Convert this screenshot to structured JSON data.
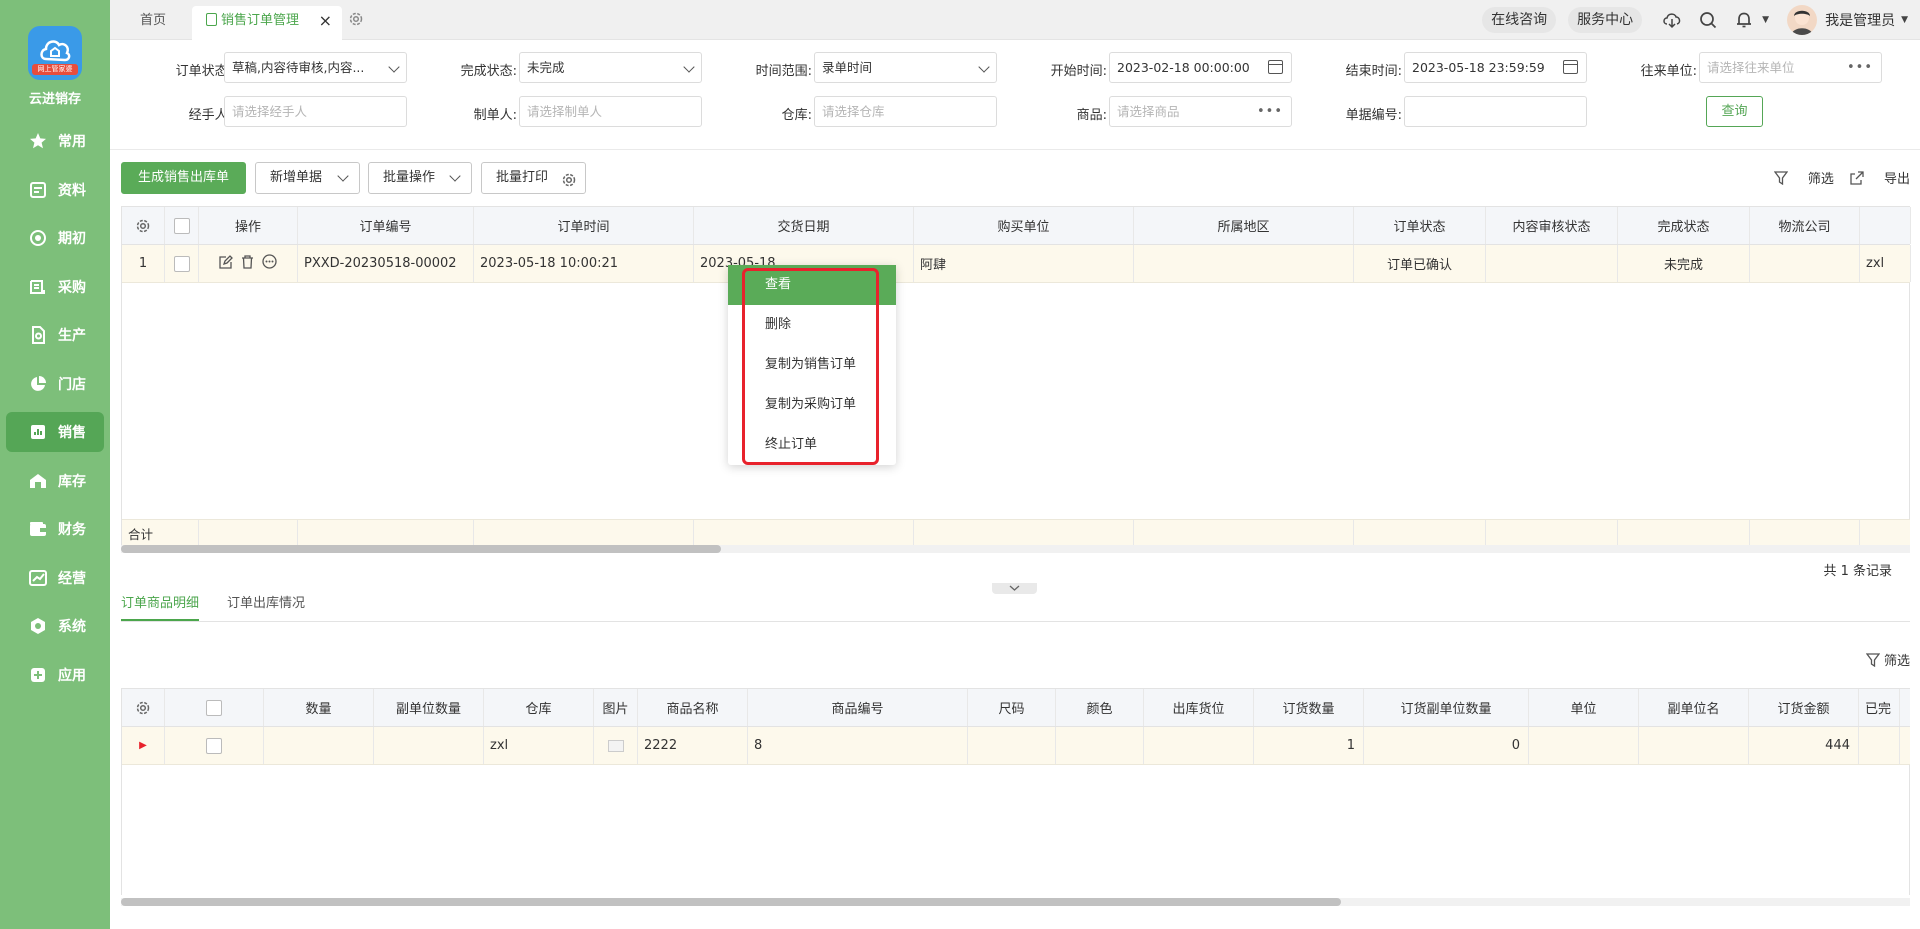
{
  "app": {
    "logo_badge": "网上管家婆",
    "logo_name": "云进销存"
  },
  "nav": [
    {
      "label": "常用",
      "icon": "star-icon"
    },
    {
      "label": "资料",
      "icon": "document-icon"
    },
    {
      "label": "期初",
      "icon": "target-icon"
    },
    {
      "label": "采购",
      "icon": "purchase-icon"
    },
    {
      "label": "生产",
      "icon": "production-icon"
    },
    {
      "label": "门店",
      "icon": "pie-icon"
    },
    {
      "label": "销售",
      "icon": "sales-chart-icon"
    },
    {
      "label": "库存",
      "icon": "warehouse-icon"
    },
    {
      "label": "财务",
      "icon": "wallet-icon"
    },
    {
      "label": "经营",
      "icon": "trend-icon"
    },
    {
      "label": "系统",
      "icon": "system-gear-icon"
    },
    {
      "label": "应用",
      "icon": "plus-square-icon"
    }
  ],
  "tabs": {
    "home": "首页",
    "active": "销售订单管理"
  },
  "topright": {
    "consult": "在线咨询",
    "service": "服务中心",
    "user": "我是管理员"
  },
  "filters": {
    "order_status_label": "订单状态:",
    "order_status_value": "草稿,内容待审核,内容...",
    "complete_status_label": "完成状态:",
    "complete_status_value": "未完成",
    "time_range_label": "时间范围:",
    "time_range_value": "录单时间",
    "start_label": "开始时间:",
    "start_value": "2023-02-18 00:00:00",
    "end_label": "结束时间:",
    "end_value": "2023-05-18 23:59:59",
    "partner_label": "往来单位:",
    "partner_placeholder": "请选择往来单位",
    "handler_label": "经手人:",
    "handler_placeholder": "请选择经手人",
    "maker_label": "制单人:",
    "maker_placeholder": "请选择制单人",
    "warehouse_label": "仓库:",
    "warehouse_placeholder": "请选择仓库",
    "goods_label": "商品:",
    "goods_placeholder": "请选择商品",
    "billno_label": "单据编号:",
    "billno_value": "",
    "query": "查询"
  },
  "toolbar": {
    "gen_out": "生成销售出库单",
    "new_bill": "新增单据",
    "batch": "批量操作",
    "batch_print": "批量打印",
    "filter": "筛选",
    "export": "导出"
  },
  "grid": {
    "headers": [
      "操作",
      "订单编号",
      "订单时间",
      "交货日期",
      "购买单位",
      "所属地区",
      "订单状态",
      "内容审核状态",
      "完成状态",
      "物流公司"
    ],
    "row": {
      "index": "1",
      "order_no": "PXXD-20230518-00002",
      "order_time": "2023-05-18 10:00:21",
      "delivery": "2023-05-18",
      "buyer": "阿肆",
      "region": "",
      "status": "订单已确认",
      "audit": "",
      "complete": "未完成",
      "logistics": "",
      "extra": "zxl"
    },
    "sum_label": "合计",
    "total": "共 1 条记录"
  },
  "context_menu": [
    "查看",
    "删除",
    "复制为销售订单",
    "复制为采购订单",
    "终止订单"
  ],
  "subtabs": [
    "订单商品明细",
    "订单出库情况"
  ],
  "detail": {
    "filter": "筛选",
    "headers": [
      "数量",
      "副单位数量",
      "仓库",
      "图片",
      "商品名称",
      "商品编号",
      "尺码",
      "颜色",
      "出库货位",
      "订货数量",
      "订货副单位数量",
      "单位",
      "副单位名",
      "订货金额",
      "已完"
    ],
    "row": {
      "warehouse": "zxl",
      "name": "2222",
      "code": "8",
      "order_qty": "1",
      "order_sub_qty": "0",
      "amount": "444"
    }
  }
}
